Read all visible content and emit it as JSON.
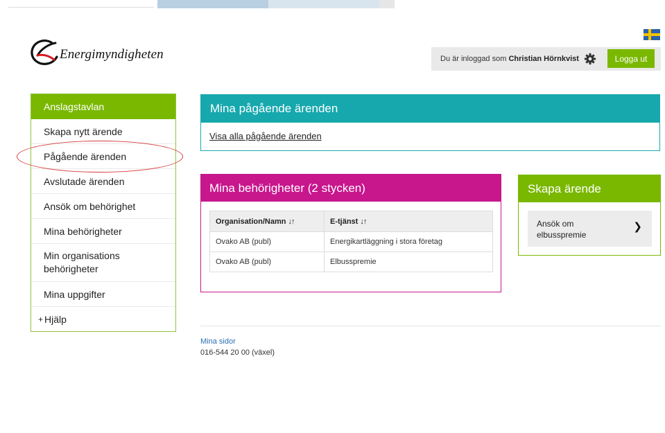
{
  "brand": {
    "name": "Energimyndigheten",
    "logo_icon": "energimyndigheten-logo",
    "accent_green": "#7ab800",
    "accent_teal": "#16a8ad",
    "accent_magenta": "#c8168d"
  },
  "header": {
    "logged_in_prefix": "Du är inloggad som",
    "user_name": "Christian Hörnkvist",
    "settings_icon": "gear-icon",
    "logout_label": "Logga ut",
    "language_icon": "swedish-flag-icon"
  },
  "sidebar": {
    "heading": "Anslagstavlan",
    "items": [
      {
        "label": "Skapa nytt ärende"
      },
      {
        "label": "Pågående ärenden"
      },
      {
        "label": "Avslutade ärenden"
      },
      {
        "label": "Ansök om behörighet"
      },
      {
        "label": "Mina behörigheter"
      },
      {
        "label": "Min organisations behörigheter"
      },
      {
        "label": "Mina uppgifter"
      },
      {
        "label": "Hjälp",
        "prefix": "+"
      }
    ]
  },
  "ongoing_panel": {
    "title": "Mina pågående ärenden",
    "link": "Visa alla pågående ärenden"
  },
  "permissions_panel": {
    "title": "Mina behörigheter (2 stycken)",
    "columns": [
      "Organisation/Namn",
      "E-tjänst"
    ],
    "sort_icon": "↓↑",
    "rows": [
      [
        "Ovako AB (publ)",
        "Energikartläggning i stora företag"
      ],
      [
        "Ovako AB (publ)",
        "Elbusspremie"
      ]
    ]
  },
  "create_panel": {
    "title": "Skapa ärende",
    "button_label": "Ansök om elbusspremie",
    "chevron_icon": "chevron-right-icon"
  },
  "footer": {
    "link": "Mina sidor",
    "phone": "016-544 20 00 (växel)"
  }
}
